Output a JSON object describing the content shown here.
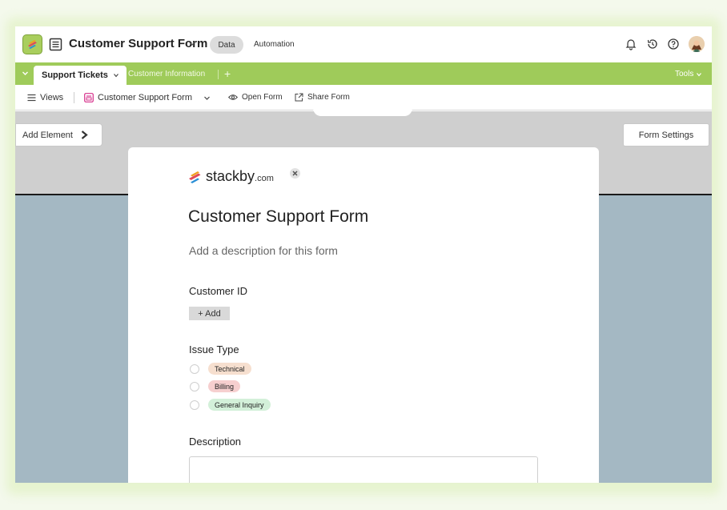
{
  "header": {
    "title": "Customer Support Form",
    "tabs": [
      "Data",
      "Automation"
    ],
    "icons": [
      "bell-icon",
      "history-icon",
      "help-icon"
    ]
  },
  "tabbar": {
    "active_tab": "Support Tickets",
    "other_tab": "Customer Information",
    "add": "+",
    "tools": "Tools"
  },
  "viewsbar": {
    "views": "Views",
    "current_view": "Customer Support Form",
    "open_form": "Open Form",
    "share_form": "Share Form"
  },
  "canvas": {
    "add_element": "Add Element",
    "form_settings": "Form Settings"
  },
  "form": {
    "logo_text": "stackby",
    "logo_domain": ".com",
    "title": "Customer Support Form",
    "description": "Add a description for this form",
    "fields": {
      "customer_id": {
        "label": "Customer ID",
        "add_label": "+ Add"
      },
      "issue_type": {
        "label": "Issue Type",
        "options": [
          {
            "label": "Technical",
            "color": "#f6dfcf"
          },
          {
            "label": "Billing",
            "color": "#f6cfcf"
          },
          {
            "label": "General Inquiry",
            "color": "#d3f0d9"
          }
        ]
      },
      "description": {
        "label": "Description",
        "value": ""
      }
    }
  },
  "colors": {
    "accent": "#9fcb5a",
    "canvas_top": "#cfcfcf",
    "canvas_bottom": "#a4b8c3"
  }
}
